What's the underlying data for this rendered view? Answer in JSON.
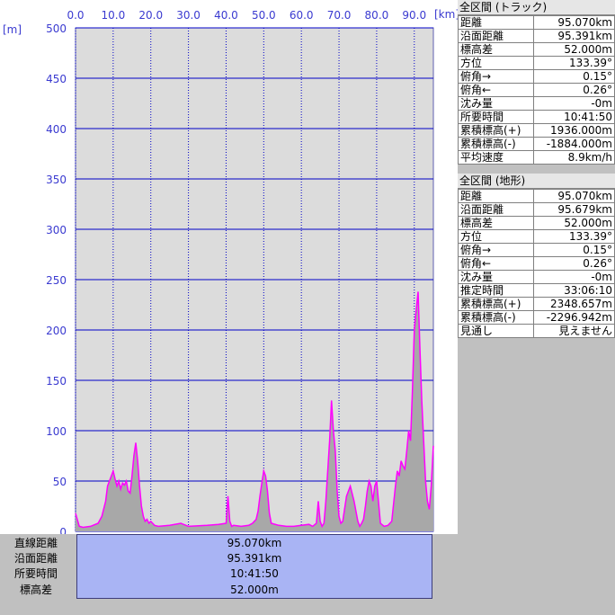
{
  "chart_data": {
    "type": "area",
    "xlabel": "[km]",
    "ylabel": "[m]",
    "xlim": [
      0,
      95.07
    ],
    "ylim": [
      0,
      500
    ],
    "x_ticks": [
      "0.0",
      "10.0",
      "20.0",
      "30.0",
      "40.0",
      "50.0",
      "60.0",
      "70.0",
      "80.0",
      "90.0"
    ],
    "y_ticks": [
      "500",
      "450",
      "400",
      "350",
      "300",
      "250",
      "200",
      "150",
      "100",
      "50",
      "0"
    ],
    "grid": true,
    "colors": {
      "plot_bg": "#dcdcdc",
      "grid": "#0000c8",
      "track": "#ff00ff",
      "terrain_fill": "#a8a8a8",
      "axis_text": "#3a3ad0"
    },
    "track_profile": {
      "x": [
        0,
        1,
        2,
        4,
        6,
        7,
        8,
        8.5,
        9,
        9.5,
        10,
        10.5,
        11,
        11.5,
        12,
        12.5,
        13,
        13.5,
        14,
        14.5,
        15,
        15.5,
        16,
        16.5,
        17,
        17.5,
        18,
        18.5,
        19,
        19.5,
        20,
        21,
        22,
        25,
        28,
        30,
        35,
        38,
        40,
        40.5,
        41,
        41.5,
        42,
        44,
        46,
        47,
        48,
        48.5,
        49,
        49.5,
        50,
        50.5,
        51,
        51.5,
        52,
        54,
        56,
        58,
        60,
        62,
        63,
        64,
        64.5,
        65,
        65.5,
        66,
        66.5,
        67,
        67.5,
        68,
        68.5,
        69,
        69.5,
        70,
        70.5,
        71,
        72,
        73,
        74,
        74.5,
        75,
        75.5,
        76,
        76.5,
        77,
        77.5,
        78,
        78.5,
        79,
        79.5,
        80,
        81,
        82,
        83,
        84,
        85,
        85.5,
        86,
        86.5,
        87,
        87.5,
        88,
        88.5,
        89,
        89.5,
        90,
        90.5,
        91,
        91.5,
        92,
        92.5,
        93,
        93.5,
        94,
        94.5,
        95.07
      ],
      "elevation": [
        18,
        5,
        4,
        5,
        8,
        15,
        30,
        45,
        50,
        55,
        60,
        52,
        45,
        50,
        42,
        48,
        46,
        50,
        40,
        38,
        55,
        75,
        88,
        70,
        45,
        25,
        15,
        10,
        12,
        8,
        10,
        6,
        5,
        6,
        8,
        5,
        6,
        7,
        8,
        35,
        10,
        5,
        6,
        5,
        6,
        8,
        12,
        20,
        35,
        48,
        60,
        55,
        40,
        18,
        8,
        6,
        5,
        5,
        6,
        7,
        5,
        8,
        30,
        10,
        5,
        8,
        30,
        60,
        90,
        130,
        100,
        80,
        40,
        15,
        8,
        10,
        35,
        45,
        30,
        20,
        10,
        5,
        8,
        12,
        25,
        40,
        50,
        45,
        30,
        45,
        50,
        8,
        5,
        6,
        10,
        45,
        60,
        55,
        70,
        65,
        62,
        80,
        100,
        90,
        140,
        200,
        220,
        238,
        180,
        130,
        90,
        50,
        30,
        22,
        45,
        85
      ]
    }
  },
  "summary": {
    "rows": [
      {
        "label": "直線距離",
        "value": "95.070km"
      },
      {
        "label": "沿面距離",
        "value": "95.391km"
      },
      {
        "label": "所要時間",
        "value": "10:41:50"
      },
      {
        "label": "標高差",
        "value": "52.000m"
      }
    ]
  },
  "panel_track": {
    "header": "全区間 (トラック)",
    "rows": [
      {
        "label": "距離",
        "value": "95.070km"
      },
      {
        "label": "沿面距離",
        "value": "95.391km"
      },
      {
        "label": "標高差",
        "value": "52.000m"
      },
      {
        "label": "方位",
        "value": "133.39°"
      },
      {
        "label": "俯角→",
        "value": "0.15°"
      },
      {
        "label": "俯角←",
        "value": "0.26°"
      },
      {
        "label": "沈み量",
        "value": "-0m"
      },
      {
        "label": "所要時間",
        "value": "10:41:50"
      },
      {
        "label": "累積標高(+)",
        "value": "1936.000m"
      },
      {
        "label": "累積標高(-)",
        "value": "-1884.000m"
      },
      {
        "label": "平均速度",
        "value": "8.9km/h"
      }
    ]
  },
  "panel_terrain": {
    "header": "全区間 (地形)",
    "rows": [
      {
        "label": "距離",
        "value": "95.070km"
      },
      {
        "label": "沿面距離",
        "value": "95.679km"
      },
      {
        "label": "標高差",
        "value": "52.000m"
      },
      {
        "label": "方位",
        "value": "133.39°"
      },
      {
        "label": "俯角→",
        "value": "0.15°"
      },
      {
        "label": "俯角←",
        "value": "0.26°"
      },
      {
        "label": "沈み量",
        "value": "-0m"
      },
      {
        "label": "推定時間",
        "value": "33:06:10"
      },
      {
        "label": "累積標高(+)",
        "value": "2348.657m"
      },
      {
        "label": "累積標高(-)",
        "value": "-2296.942m"
      },
      {
        "label": "見通し",
        "value": "見えません"
      }
    ]
  }
}
